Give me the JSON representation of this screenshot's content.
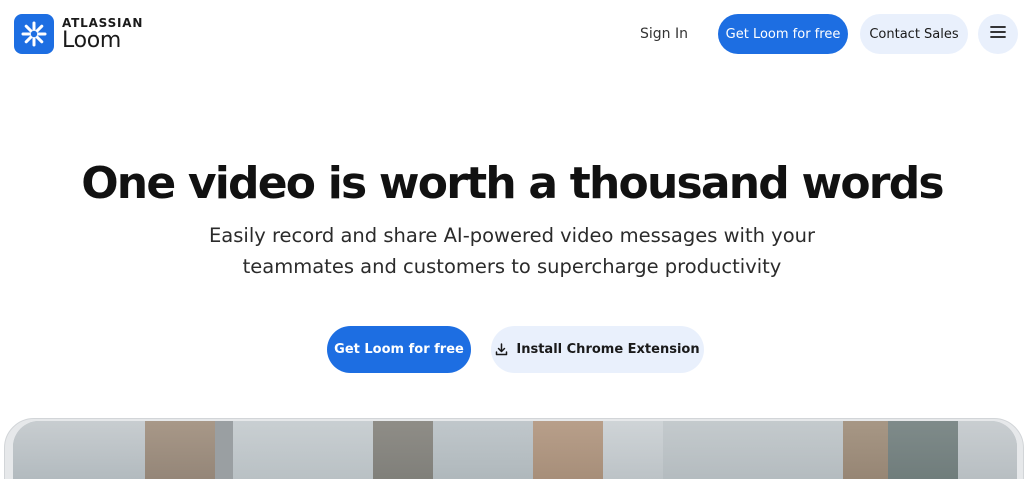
{
  "brand": {
    "company": "ATLASSIAN",
    "product": "Loom",
    "color": "#1d6ee2",
    "icon": "loom-asterisk-icon"
  },
  "nav": {
    "sign_in": "Sign In",
    "get_loom": "Get Loom for free",
    "contact_sales": "Contact Sales",
    "menu_icon": "hamburger-menu-icon"
  },
  "hero": {
    "title": "One video is worth a thousand words",
    "subtitle_line1": "Easily record and share AI-powered video messages with your",
    "subtitle_line2": "teammates and customers to supercharge productivity",
    "primary_cta": "Get Loom for free",
    "secondary_cta": "Install Chrome Extension",
    "secondary_icon": "download-icon"
  },
  "colors": {
    "primary": "#1d6ee2",
    "secondary_bg": "#e9f0fc",
    "text": "#111111"
  }
}
